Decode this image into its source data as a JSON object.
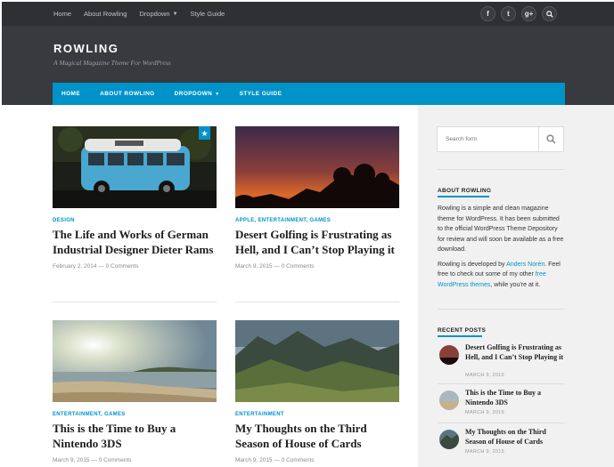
{
  "topnav": {
    "items": [
      "Home",
      "About Rowling",
      "Dropdown",
      "Style Guide"
    ],
    "social_icons": [
      "facebook-icon",
      "twitter-icon",
      "google-plus-icon",
      "search-icon"
    ],
    "social_glyphs": [
      "f",
      "t",
      "g+",
      "⌕"
    ]
  },
  "site": {
    "title": "ROWLING",
    "description": "A Magical Magazine Theme For WordPress"
  },
  "mainnav": {
    "items": [
      "HOME",
      "ABOUT ROWLING",
      "DROPDOWN",
      "STYLE GUIDE"
    ]
  },
  "posts": [
    {
      "category": "DESIGN",
      "title": "The Life and Works of German Industrial Designer Dieter Rams",
      "date": "February 2, 2014",
      "comments": "0 Comments"
    },
    {
      "category": "APPLE, ENTERTAINMENT, GAMES",
      "title": "Desert Golfing is Frustrating as Hell, and I Can’t Stop Playing it",
      "date": "March 9, 2015",
      "comments": "0 Comments"
    },
    {
      "category": "ENTERTAINMENT, GAMES",
      "title": "This is the Time to Buy a Nintendo 3DS",
      "date": "March 9, 2015",
      "comments": "0 Comments"
    },
    {
      "category": "ENTERTAINMENT",
      "title": "My Thoughts on the Third Season of House of Cards",
      "date": "March 9, 2015",
      "comments": "0 Comments"
    }
  ],
  "meta_separator": "—",
  "sidebar": {
    "search_placeholder": "Search form",
    "about_title": "ABOUT ROWLING",
    "about_p1": "Rowling is a simple and clean magazine theme for WordPress. It has been submitted to the official WordPress Theme Depository for review and will soon be available as a free download.",
    "about_p2_pre": "Rowling is developed by ",
    "about_p2_link1": "Anders Norén",
    "about_p2_mid": ". Feel free to check out some of my other ",
    "about_p2_link2": "free WordPress themes",
    "about_p2_post": ", while you're at it.",
    "recent_title": "RECENT POSTS",
    "recent": [
      {
        "title": "Desert Golfing is Frustrating as Hell, and I Can’t Stop Playing it",
        "date": "MARCH 9, 2015"
      },
      {
        "title": "This is the Time to Buy a Nintendo 3DS",
        "date": "MARCH 9, 2015"
      },
      {
        "title": "My Thoughts on the Third Season of House of Cards",
        "date": "MARCH 9, 2015"
      }
    ]
  },
  "colors": {
    "accent": "#0093c9",
    "topbar": "#2e3033",
    "header": "#383a3d",
    "sidebar": "#f1f1f1"
  }
}
